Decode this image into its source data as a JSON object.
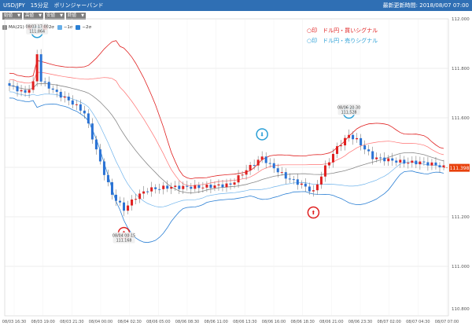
{
  "header": {
    "title": "USD/JPY　15分足　ボリンジャーバンド",
    "updated_label": "最新更新時間: 2018/08/07 07:00"
  },
  "toolbar": {
    "buttons": [
      {
        "label": "始値"
      },
      {
        "label": "高値"
      },
      {
        "label": "安値"
      },
      {
        "label": "終値"
      }
    ]
  },
  "indicator_legend": [
    {
      "label": "MA(21)",
      "color": "#888888"
    },
    {
      "label": "1σ",
      "color": "#ff6666"
    },
    {
      "label": "2σ",
      "color": "#e02020"
    },
    {
      "label": "−1σ",
      "color": "#66aee8"
    },
    {
      "label": "−2σ",
      "color": "#2a7fd4"
    }
  ],
  "signal_legend": {
    "buy": {
      "label": "○印　ドル円・買いシグナル",
      "color": "#e02020"
    },
    "sell": {
      "label": "○印　ドル円・売りシグナル",
      "color": "#2a9fd6"
    }
  },
  "colors": {
    "up": "#e02020",
    "down": "#2a72d4",
    "ma": "#888888",
    "sigma1": "#ff7070",
    "sigma2": "#e02020",
    "minus1": "#70b4ec",
    "minus2": "#2a7fd4",
    "grid": "#dddddd",
    "price_tag": "#e8410c"
  },
  "price_tag": "111.398",
  "chart_data": {
    "type": "candlestick",
    "symbol": "USD/JPY",
    "interval": "15分足",
    "ylim": [
      110.8,
      112.0
    ],
    "y_ticks": [
      "111.000",
      "111.200",
      "111.400",
      "111.600",
      "111.800",
      "112.000",
      "110.800"
    ],
    "x_ticks": [
      "08/03 16:30",
      "08/03 19:00",
      "08/03 21:30",
      "08/04 00:00",
      "08/04 02:30",
      "08/06 05:00",
      "08/06 08:30",
      "08/06 11:00",
      "08/06 13:30",
      "08/06 16:00",
      "08/06 18:30",
      "08/06 21:00",
      "08/06 23:30",
      "08/07 02:00",
      "08/07 04:30",
      "08/07 07:00"
    ],
    "close_anchors": [
      [
        0,
        111.73
      ],
      [
        4,
        111.7
      ],
      [
        6,
        111.74
      ],
      [
        7,
        111.86
      ],
      [
        8,
        111.75
      ],
      [
        12,
        111.7
      ],
      [
        16,
        111.66
      ],
      [
        19,
        111.62
      ],
      [
        23,
        111.42
      ],
      [
        26,
        111.29
      ],
      [
        29,
        111.23
      ],
      [
        32,
        111.28
      ],
      [
        35,
        111.31
      ],
      [
        40,
        111.32
      ],
      [
        48,
        111.32
      ],
      [
        56,
        111.33
      ],
      [
        60,
        111.39
      ],
      [
        64,
        111.44
      ],
      [
        66,
        111.41
      ],
      [
        70,
        111.36
      ],
      [
        74,
        111.33
      ],
      [
        77,
        111.3
      ],
      [
        80,
        111.4
      ],
      [
        83,
        111.48
      ],
      [
        86,
        111.53
      ],
      [
        88,
        111.51
      ],
      [
        92,
        111.44
      ],
      [
        96,
        111.43
      ],
      [
        100,
        111.42
      ],
      [
        104,
        111.42
      ],
      [
        108,
        111.41
      ],
      [
        110,
        111.4
      ]
    ],
    "count": 111,
    "annotations": [
      {
        "kind": "sell",
        "label": "08/03 17:00",
        "value": "111.864",
        "index": 7
      },
      {
        "kind": "buy",
        "label": "08/04 00:15",
        "value": "111.168",
        "index": 29
      },
      {
        "kind": "sell",
        "label": "",
        "value": "",
        "index": 64
      },
      {
        "kind": "buy",
        "label": "",
        "value": "",
        "index": 77
      },
      {
        "kind": "sell",
        "label": "08/06 20:30",
        "value": "111.528",
        "index": 86
      }
    ]
  }
}
